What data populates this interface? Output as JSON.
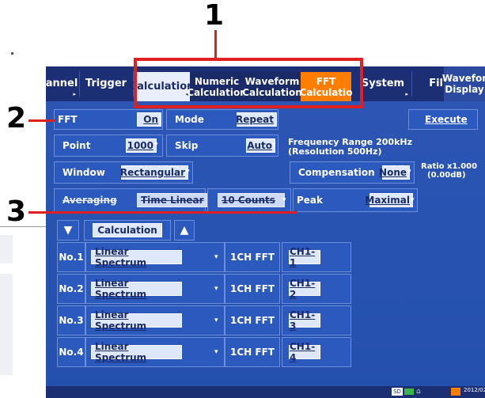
{
  "annotations": {
    "n1": "1",
    "n2": "2",
    "n3": "3"
  },
  "tabs": [
    {
      "label": "annel"
    },
    {
      "label": "Trigger"
    },
    {
      "label": "Calculation"
    },
    {
      "line1": "Numeric",
      "line2": "Calculation"
    },
    {
      "line1": "Waveform",
      "line2": "Calculation"
    },
    {
      "line1": "FFT",
      "line2": "Calculatio"
    },
    {
      "label": "System"
    },
    {
      "label": "Fil"
    },
    {
      "line1": "Wavefor",
      "line2": "Display"
    }
  ],
  "fft": {
    "label": "FFT",
    "value": "On"
  },
  "mode": {
    "label": "Mode",
    "value": "Repeat"
  },
  "execute": {
    "label": "Execute"
  },
  "point": {
    "label": "Point",
    "value": "1000"
  },
  "skip": {
    "label": "Skip",
    "value": "Auto"
  },
  "freq": {
    "line1": "Frequency Range 200kHz",
    "line2": "(Resolution 500Hz)"
  },
  "window": {
    "label": "Window",
    "value": "Rectangular"
  },
  "compensation": {
    "label": "Compensation",
    "value": "None"
  },
  "ratio": {
    "line1": "Ratio x1.000",
    "line2": "(0.00dB)"
  },
  "averaging": {
    "label": "Averaging",
    "value": "Time Linear",
    "count": "10 Counts"
  },
  "peak": {
    "label": "Peak",
    "value": "Maximal"
  },
  "calc_header": {
    "label": "Calculation"
  },
  "rows": [
    {
      "no": "No.1",
      "analysis": "Linear Spectrum",
      "mode": "1CH FFT",
      "ch": "CH1-1"
    },
    {
      "no": "No.2",
      "analysis": "Linear Spectrum",
      "mode": "1CH FFT",
      "ch": "CH1-2"
    },
    {
      "no": "No.3",
      "analysis": "Linear Spectrum",
      "mode": "1CH FFT",
      "ch": "CH1-3"
    },
    {
      "no": "No.4",
      "analysis": "Linear Spectrum",
      "mode": "1CH FFT",
      "ch": "CH1-4"
    }
  ],
  "status": {
    "sd": "SD",
    "date": "2012/02"
  }
}
